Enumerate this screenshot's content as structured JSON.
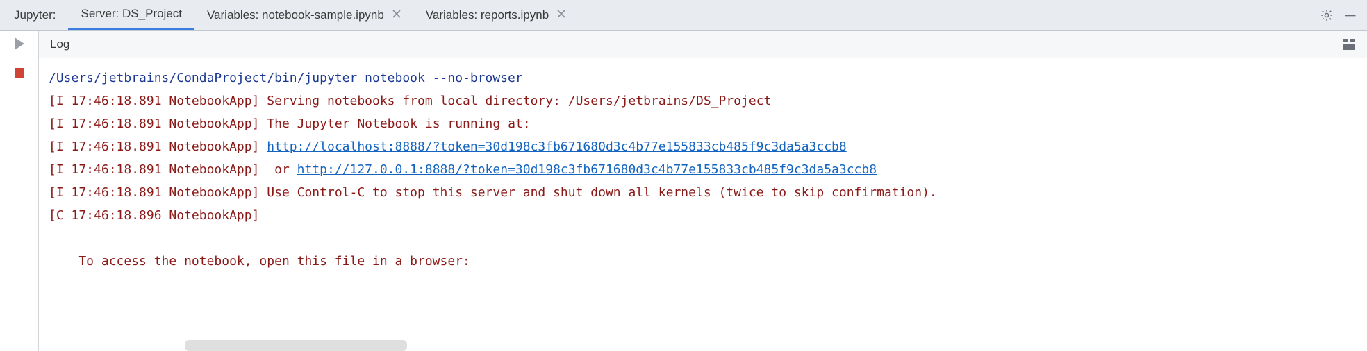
{
  "header": {
    "title": "Jupyter:",
    "tabs": [
      {
        "label": "Server: DS_Project",
        "closable": false,
        "active": true
      },
      {
        "label": "Variables: notebook-sample.ipynb",
        "closable": true,
        "active": false
      },
      {
        "label": "Variables: reports.ipynb",
        "closable": true,
        "active": false
      }
    ]
  },
  "log": {
    "title": "Log",
    "lines": [
      {
        "type": "cmd",
        "text": "/Users/jetbrains/CondaProject/bin/jupyter notebook --no-browser"
      },
      {
        "type": "info",
        "prefix": "[I 17:46:18.891 NotebookApp] ",
        "text": "Serving notebooks from local directory: /Users/jetbrains/DS_Project"
      },
      {
        "type": "info",
        "prefix": "[I 17:46:18.891 NotebookApp] ",
        "text": "The Jupyter Notebook is running at:"
      },
      {
        "type": "info_link",
        "prefix": "[I 17:46:18.891 NotebookApp] ",
        "link": "http://localhost:8888/?token=30d198c3fb671680d3c4b77e155833cb485f9c3da5a3ccb8"
      },
      {
        "type": "info_link_or",
        "prefix": "[I 17:46:18.891 NotebookApp]  ",
        "or_text": "or ",
        "link": "http://127.0.0.1:8888/?token=30d198c3fb671680d3c4b77e155833cb485f9c3da5a3ccb8"
      },
      {
        "type": "info",
        "prefix": "[I 17:46:18.891 NotebookApp] ",
        "text": "Use Control-C to stop this server and shut down all kernels (twice to skip confirmation)."
      },
      {
        "type": "info",
        "prefix": "[C 17:46:18.896 NotebookApp]",
        "text": ""
      },
      {
        "type": "blank"
      },
      {
        "type": "info_indent",
        "text": "    To access the notebook, open this file in a browser:"
      }
    ]
  }
}
